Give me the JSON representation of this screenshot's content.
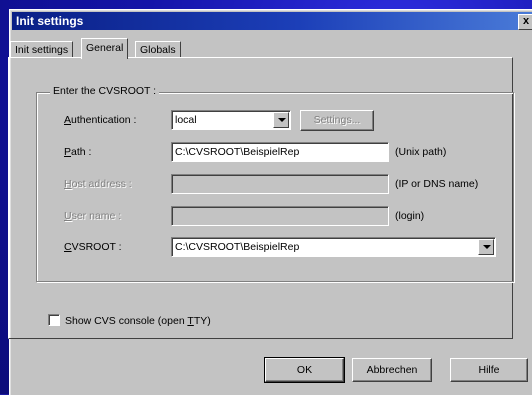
{
  "window": {
    "title": "Init settings",
    "close_label": "x"
  },
  "tabs": [
    {
      "label": "Init settings",
      "active": false
    },
    {
      "label": "General",
      "active": true
    },
    {
      "label": "Globals",
      "active": false
    }
  ],
  "group": {
    "legend": "Enter the CVSROOT :"
  },
  "fields": {
    "authentication": {
      "label": "Authentication :",
      "value": "local"
    },
    "settings_button": "Settings...",
    "path": {
      "label": "Path :",
      "value": "C:\\CVSROOT\\BeispielRep",
      "hint": "(Unix path)"
    },
    "host": {
      "label": "Host address :",
      "value": "",
      "hint": "(IP or DNS name)"
    },
    "user": {
      "label": "User name :",
      "value": "",
      "hint": "(login)"
    },
    "cvsroot": {
      "label": "CVSROOT :",
      "value": "C:\\CVSROOT\\BeispielRep"
    }
  },
  "checkbox": {
    "label": "Show CVS console (open TTY)",
    "checked": false
  },
  "buttons": {
    "ok": "OK",
    "cancel": "Abbrechen",
    "help": "Hilfe"
  }
}
